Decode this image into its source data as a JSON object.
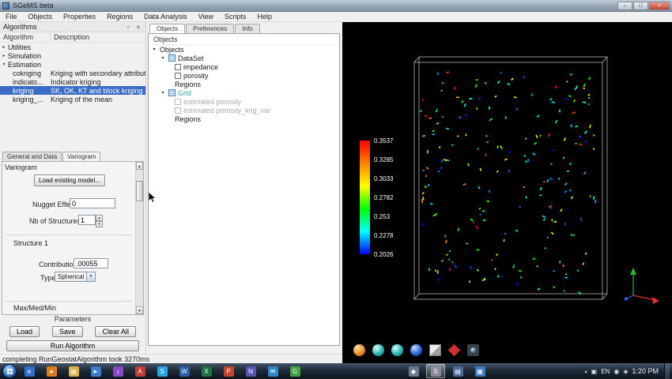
{
  "window": {
    "title": "SGeMS beta",
    "controls": {
      "minimize": "–",
      "maximize": "□",
      "close": "×"
    }
  },
  "menu": {
    "items": [
      "File",
      "Objects",
      "Properties",
      "Regions",
      "Data Analysis",
      "View",
      "Scripts",
      "Help"
    ]
  },
  "algorithms_panel": {
    "title": "Algorithms",
    "columns": [
      "Algorithm",
      "Description"
    ],
    "groups": [
      {
        "label": "Utilities",
        "expanded": false,
        "children": []
      },
      {
        "label": "Simulation",
        "expanded": false,
        "children": []
      },
      {
        "label": "Estimation",
        "expanded": true,
        "children": [
          {
            "name": "cokriging",
            "desc": "Kriging with secondary attribute",
            "selected": false
          },
          {
            "name": "indicato...",
            "desc": "Indicator kriging",
            "selected": false
          },
          {
            "name": "kriging",
            "desc": "SK, OK, KT and block kriging",
            "selected": true
          },
          {
            "name": "kriging_...",
            "desc": "Kriging of the mean",
            "selected": false
          }
        ]
      }
    ],
    "tabs": [
      {
        "label": "General and Data",
        "active": false
      },
      {
        "label": "Variogram",
        "active": true
      }
    ],
    "variogram": {
      "section_label": "Variogram",
      "load_button": "Load existing model...",
      "nugget_label": "Nugget Effect",
      "nugget_value": "0",
      "structures_label": "Nb of Structures",
      "structures_value": "1",
      "structure_header": "Structure 1",
      "contribution_label": "Contribution",
      "contribution_value": ".00055",
      "type_label": "Type",
      "type_value": "Spherical",
      "clipped_label": "Max/Med/Min"
    },
    "parameters_label": "Parameters",
    "param_buttons": [
      "Load",
      "Save",
      "Clear All"
    ],
    "run_button": "Run Algorithm"
  },
  "status_bar": {
    "text": "completing RunGeostatAlgorithm took 3270ms"
  },
  "objects_panel": {
    "tabs": [
      {
        "label": "Objects",
        "active": true
      },
      {
        "label": "Preferences",
        "active": false
      },
      {
        "label": "Info",
        "active": false
      }
    ],
    "header": "Objects",
    "root": "Objects",
    "groups": [
      {
        "name": "DataSet",
        "colored": false,
        "items": [
          {
            "label": "impedance",
            "checkbox": true,
            "checked": false,
            "disabled": false
          },
          {
            "label": "porosity",
            "checkbox": true,
            "checked": false,
            "disabled": false
          },
          {
            "label": "Regions",
            "checkbox": false,
            "disabled": false
          }
        ]
      },
      {
        "name": "Grid",
        "colored": true,
        "items": [
          {
            "label": "estimated porosity",
            "checkbox": true,
            "checked": false,
            "disabled": true
          },
          {
            "label": "estimated porosity_krig_var",
            "checkbox": true,
            "checked": false,
            "disabled": true
          },
          {
            "label": "Regions",
            "checkbox": false,
            "disabled": false
          }
        ]
      }
    ]
  },
  "viewport": {
    "colorbar": {
      "tick_labels": [
        "0.3537",
        "0.3285",
        "0.3033",
        "0.2782",
        "0.253",
        "0.2278",
        "0.2026"
      ],
      "gradient": [
        "#ff0000",
        "#ff8000",
        "#ffff00",
        "#00ff00",
        "#00ffff",
        "#0000ff"
      ]
    },
    "scatter": {
      "seed": 987654321,
      "count": 210
    },
    "toolbar": [
      {
        "name": "home-view-icon",
        "kind": "sphere-orange"
      },
      {
        "name": "top-view-icon",
        "kind": "globe-teal"
      },
      {
        "name": "face-view-icon",
        "kind": "globe-teal"
      },
      {
        "name": "perspective-view-icon",
        "kind": "sphere-blue"
      },
      {
        "name": "bounding-box-icon",
        "kind": "cube"
      },
      {
        "name": "pick-mode-icon",
        "kind": "pick-red"
      },
      {
        "name": "snapshot-icon",
        "kind": "camera"
      }
    ]
  },
  "taskbar": {
    "pinned": [
      {
        "glyph": "e",
        "bg": "#2f6fd0"
      },
      {
        "glyph": "●",
        "bg": "#e07a1f"
      },
      {
        "glyph": "▤",
        "bg": "#d8b44a"
      },
      {
        "glyph": "►",
        "bg": "#3f7ad0"
      },
      {
        "glyph": "♪",
        "bg": "#8a46c8"
      },
      {
        "glyph": "A",
        "bg": "#c43b3b"
      },
      {
        "glyph": "S",
        "bg": "#2aa4e0"
      },
      {
        "glyph": "W",
        "bg": "#2a5ca8"
      },
      {
        "glyph": "X",
        "bg": "#1e7145"
      },
      {
        "glyph": "P",
        "bg": "#c0452a"
      },
      {
        "glyph": "N",
        "bg": "#5a52b4"
      },
      {
        "glyph": "✉",
        "bg": "#2f86c8"
      },
      {
        "glyph": "G",
        "bg": "#3fa045"
      }
    ],
    "running": [
      {
        "glyph": "◆",
        "bg": "#6a7a8a",
        "active": false
      },
      {
        "glyph": "S",
        "bg": "#8a8a9a",
        "active": true
      },
      {
        "glyph": "▤",
        "bg": "#4a6a9a",
        "active": false
      },
      {
        "glyph": "▦",
        "bg": "#3a7ac0",
        "active": false
      }
    ],
    "tray": {
      "expand_glyph": "▴",
      "language": "EN",
      "icons": [
        "▣",
        "◉",
        "◈"
      ],
      "clock": "1:20 PM"
    }
  }
}
